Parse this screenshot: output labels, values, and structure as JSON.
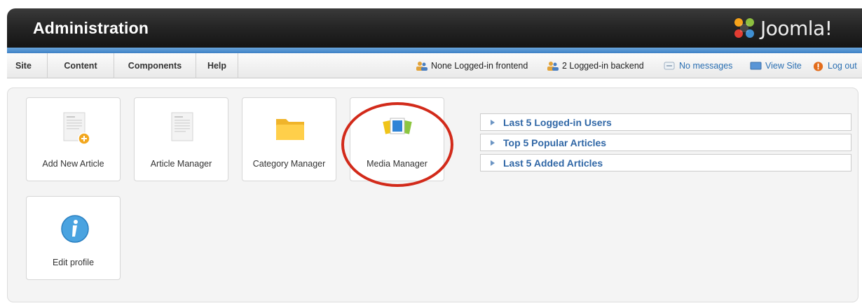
{
  "header": {
    "title": "Administration",
    "logo_text": "Joomla!"
  },
  "menu": {
    "items": [
      "Site",
      "Content",
      "Components",
      "Help"
    ]
  },
  "status": {
    "frontend": "None Logged-in frontend",
    "backend": "2 Logged-in backend",
    "messages": "No messages",
    "view_site": "View Site",
    "logout": "Log out"
  },
  "quickicons": [
    {
      "label": "Add New Article",
      "icon": "add-article-icon"
    },
    {
      "label": "Article Manager",
      "icon": "article-icon"
    },
    {
      "label": "Category Manager",
      "icon": "folder-icon"
    },
    {
      "label": "Media Manager",
      "icon": "media-icon"
    },
    {
      "label": "Edit profile",
      "icon": "info-icon"
    }
  ],
  "modules": [
    {
      "label": "Last 5 Logged-in Users"
    },
    {
      "label": "Top 5 Popular Articles"
    },
    {
      "label": "Last 5 Added Articles"
    }
  ],
  "colors": {
    "accent": "#3d80c4",
    "link": "#2a6fb2",
    "highlight_circle": "#d22a1a"
  }
}
